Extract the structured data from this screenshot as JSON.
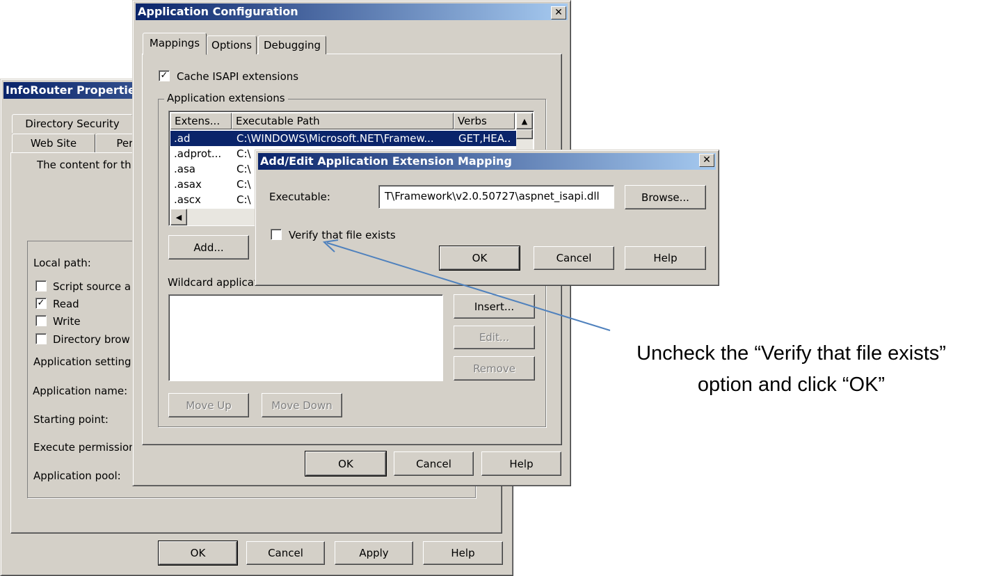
{
  "properties_window": {
    "title": "InfoRouter Propertie",
    "tabs": [
      "Directory Security",
      "Web Site",
      "Perf"
    ],
    "content_text": "The content for th",
    "local_path_label": "Local path:",
    "checkboxes": [
      {
        "label": "Script source a",
        "checked": false
      },
      {
        "label": "Read",
        "checked": true
      },
      {
        "label": "Write",
        "checked": false
      },
      {
        "label": "Directory brow",
        "checked": false
      }
    ],
    "fields": [
      "Application setting:",
      "Application name:",
      "Starting point:",
      "Execute permission",
      "Application pool:"
    ],
    "buttons": {
      "ok": "OK",
      "cancel": "Cancel",
      "apply": "Apply",
      "help": "Help"
    }
  },
  "app_config": {
    "title": "Application Configuration",
    "close": "✕",
    "tabs": [
      "Mappings",
      "Options",
      "Debugging"
    ],
    "active_tab": "Mappings",
    "cache_label": "Cache ISAPI extensions",
    "cache_checked": true,
    "group_label": "Application extensions",
    "columns": [
      "Extens...",
      "Executable Path",
      "Verbs"
    ],
    "rows": [
      {
        "ext": ".ad",
        "path": "C:\\WINDOWS\\Microsoft.NET\\Framew...",
        "verbs": "GET,HEA..",
        "selected": true
      },
      {
        "ext": ".adprot...",
        "path": "C:\\",
        "verbs": ""
      },
      {
        "ext": ".asa",
        "path": "C:\\",
        "verbs": ""
      },
      {
        "ext": ".asax",
        "path": "C:\\",
        "verbs": ""
      },
      {
        "ext": ".ascx",
        "path": "C:\\",
        "verbs": ""
      }
    ],
    "add_button": "Add...",
    "wildcard_label": "Wildcard applicat",
    "insert": "Insert...",
    "edit": "Edit...",
    "remove": "Remove",
    "move_up": "Move Up",
    "move_down": "Move Down",
    "ok": "OK",
    "cancel": "Cancel",
    "help": "Help"
  },
  "mapping_dialog": {
    "title": "Add/Edit Application Extension Mapping",
    "close": "✕",
    "executable_label": "Executable:",
    "executable_value": "T\\Framework\\v2.0.50727\\aspnet_isapi.dll",
    "browse": "Browse...",
    "verify_label": "Verify that file exists",
    "verify_checked": false,
    "ok": "OK",
    "cancel": "Cancel",
    "help": "Help"
  },
  "annotation": {
    "line1": "Uncheck the “Verify that file exists”",
    "line2": "option and click “OK”",
    "arrow_color": "#4f81bd"
  }
}
